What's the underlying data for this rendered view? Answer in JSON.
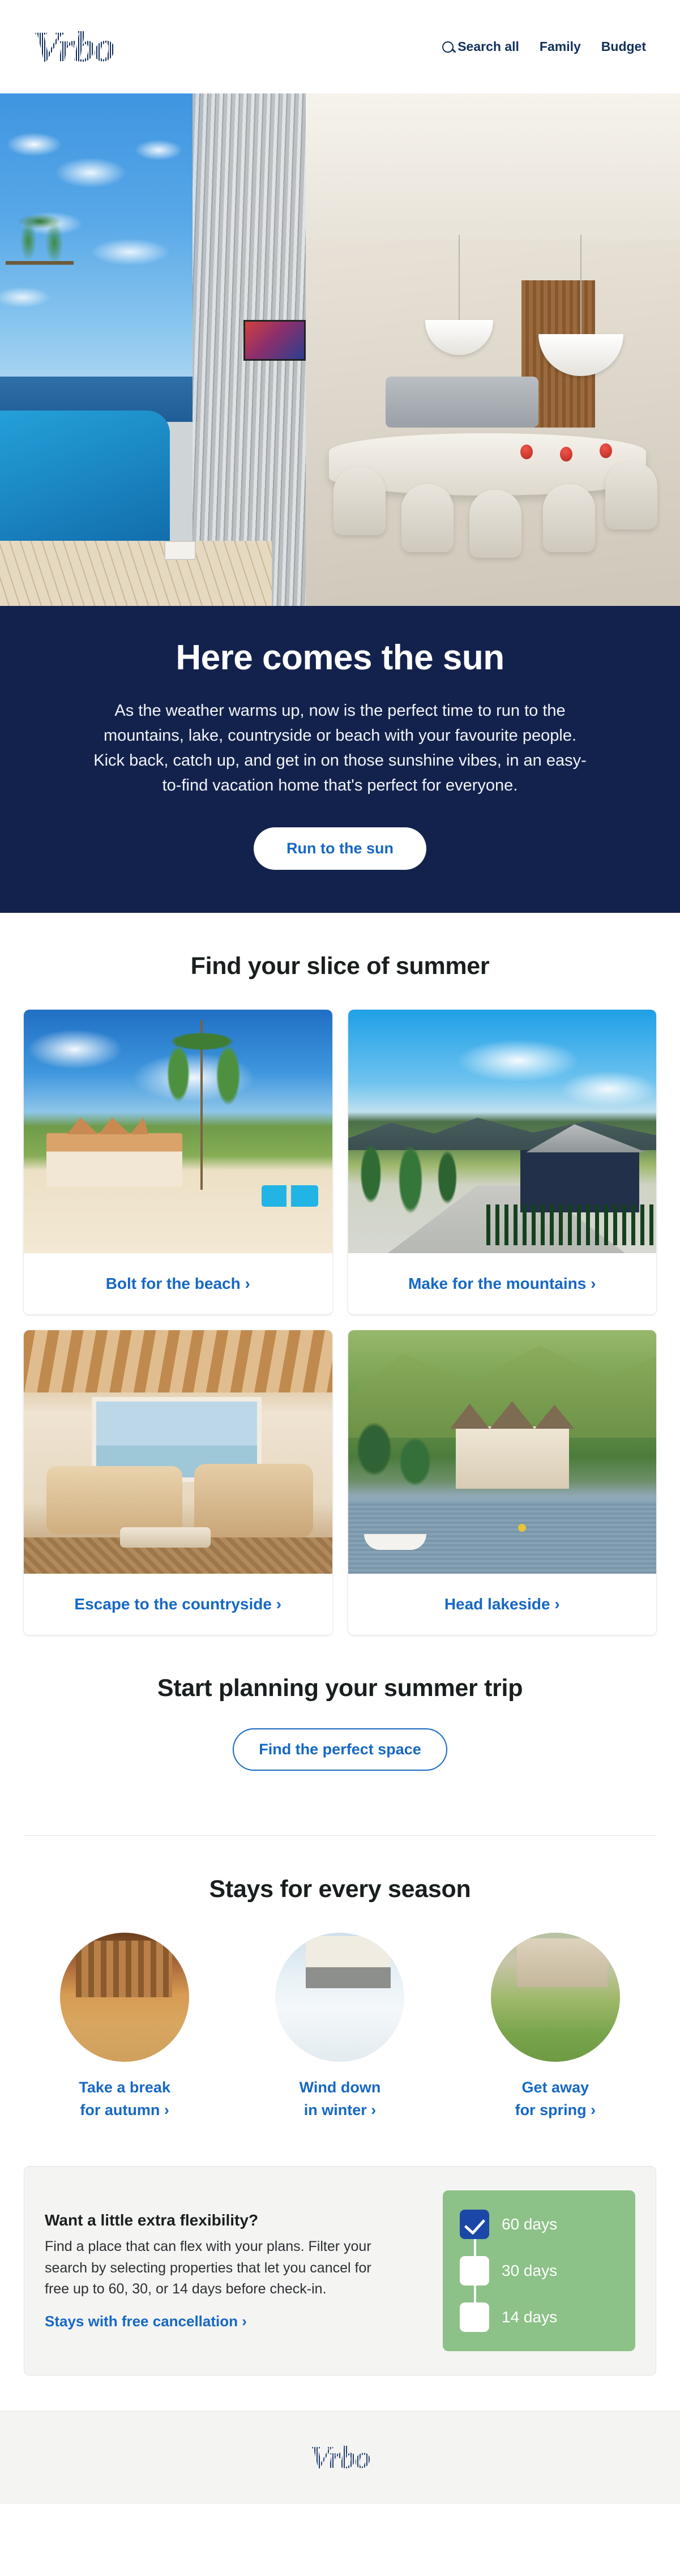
{
  "brand": {
    "name": "Vrbo",
    "logo_color": "#12305e",
    "accent_link": "#1668c4",
    "navy": "#13224d",
    "green_panel": "#8cc187",
    "checkbox_checked": "#1b48a8"
  },
  "header": {
    "logo": "Vrbo",
    "nav": [
      {
        "icon": "search-icon",
        "label": "Search all"
      },
      {
        "icon": "",
        "label": "Family"
      },
      {
        "icon": "",
        "label": "Budget"
      }
    ]
  },
  "hero": {
    "title": "Here comes the sun",
    "body": "As the weather warms up, now is the perfect time to run to the mountains, lake, countryside or beach with your favourite people. Kick back, catch up, and get in on those sunshine vibes, in an easy-to-find vacation home that's perfect for everyone.",
    "cta": "Run to the sun",
    "image_alt": "poolside deck with ocean view opening onto a modern dining room"
  },
  "summer": {
    "title": "Find your slice of summer",
    "cards": [
      {
        "label": "Bolt for the beach ›",
        "image_alt": "beachfront villa with palm trees and loungers"
      },
      {
        "label": "Make for the mountains ›",
        "image_alt": "dark blue mountain cabin with gravel drive and fence"
      },
      {
        "label": "Escape to the countryside ›",
        "image_alt": "rustic country living room with wooden beams and sofas"
      },
      {
        "label": "Head lakeside ›",
        "image_alt": "lakeside manor house with rowing boat on the water"
      }
    ]
  },
  "planning": {
    "title": "Start planning your summer trip",
    "cta": "Find the perfect space"
  },
  "seasons": {
    "title": "Stays for every season",
    "items": [
      {
        "line1": "Take a break",
        "line2": "for autumn ›",
        "image_alt": "autumn cabin terrace with hot tub"
      },
      {
        "line1": "Wind down",
        "line2": "in winter ›",
        "image_alt": "snow covered chalet in winter"
      },
      {
        "line1": "Get away",
        "line2": "for spring ›",
        "image_alt": "stone cottage with green spring garden"
      }
    ]
  },
  "flexibility": {
    "heading": "Want a little extra flexibility?",
    "body": "Find a place that can flex with your plans. Filter your search by selecting properties that let you cancel for free up to 60, 30, or 14 days before check-in.",
    "link": "Stays with free cancellation ›",
    "options": [
      {
        "label": "60 days",
        "checked": true
      },
      {
        "label": "30 days",
        "checked": false
      },
      {
        "label": "14 days",
        "checked": false
      }
    ]
  },
  "footer": {
    "logo": "Vrbo"
  }
}
